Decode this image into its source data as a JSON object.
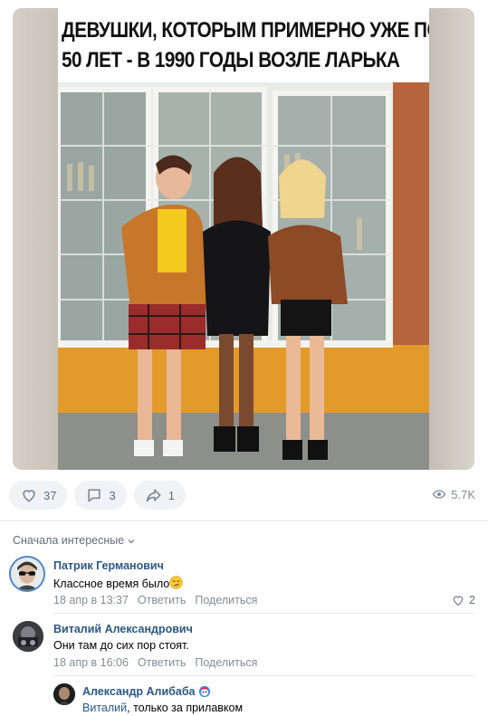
{
  "post": {
    "caption_line1": "ДЕВУШКИ, КОТОРЫМ ПРИМЕРНО УЖЕ ПО",
    "caption_line2": "50 ЛЕТ - В 1990 ГОДЫ ВОЗЛЕ ЛАРЬКА",
    "actions": {
      "likes": "37",
      "comments": "3",
      "shares": "1",
      "views": "5.7K"
    }
  },
  "comments_sort": "Сначала интересные",
  "comments": [
    {
      "author": "Патрик Германович",
      "text": "Классное время было",
      "date": "18 апр в 13:37",
      "reply_label": "Ответить",
      "share_label": "Поделиться",
      "likes": "2"
    },
    {
      "author": "Виталий Александрович",
      "text": "Они там до сих пор стоят.",
      "date": "18 апр в 16:06",
      "reply_label": "Ответить",
      "share_label": "Поделиться"
    }
  ],
  "reply": {
    "author": "Александр Алибаба",
    "reply_to": "Виталий",
    "text": ", только за прилавком"
  },
  "colors": {
    "link": "#2a5885",
    "muted": "#818c99",
    "pill_bg": "#f0f2f5"
  }
}
